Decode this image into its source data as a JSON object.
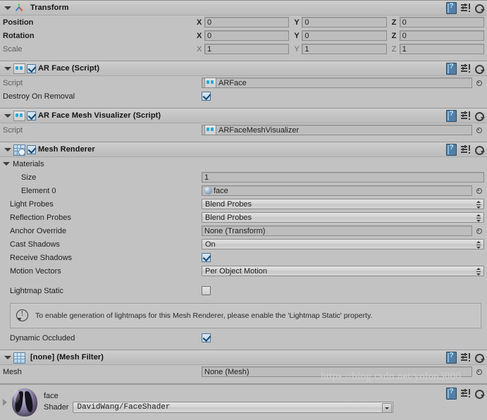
{
  "components": {
    "transform": {
      "title": "Transform",
      "rows": [
        {
          "label": "Position",
          "bold": true,
          "axes": [
            "X",
            "Y",
            "Z"
          ],
          "values": [
            "0",
            "0",
            "0"
          ]
        },
        {
          "label": "Rotation",
          "bold": true,
          "axes": [
            "X",
            "Y",
            "Z"
          ],
          "values": [
            "0",
            "0",
            "0"
          ]
        },
        {
          "label": "Scale",
          "bold": false,
          "axes": [
            "X",
            "Y",
            "Z"
          ],
          "values": [
            "1",
            "1",
            "1"
          ]
        }
      ]
    },
    "ar_face": {
      "title": "AR Face (Script)",
      "enabled": true,
      "script_label": "Script",
      "script_value": "ARFace",
      "destroy_label": "Destroy On Removal",
      "destroy_checked": true
    },
    "ar_face_mesh_visualizer": {
      "title": "AR Face Mesh Visualizer (Script)",
      "enabled": true,
      "script_label": "Script",
      "script_value": "ARFaceMeshVisualizer"
    },
    "mesh_renderer": {
      "title": "Mesh Renderer",
      "enabled": true,
      "materials_label": "Materials",
      "size_label": "Size",
      "size_value": "1",
      "element0_label": "Element 0",
      "element0_value": "face",
      "light_probes_label": "Light Probes",
      "light_probes_value": "Blend Probes",
      "reflection_probes_label": "Reflection Probes",
      "reflection_probes_value": "Blend Probes",
      "anchor_override_label": "Anchor Override",
      "anchor_override_value": "None (Transform)",
      "cast_shadows_label": "Cast Shadows",
      "cast_shadows_value": "On",
      "receive_shadows_label": "Receive Shadows",
      "receive_shadows_checked": true,
      "motion_vectors_label": "Motion Vectors",
      "motion_vectors_value": "Per Object Motion",
      "lightmap_static_label": "Lightmap Static",
      "lightmap_static_checked": false,
      "info_message": "To enable generation of lightmaps for this Mesh Renderer, please enable the 'Lightmap Static' property.",
      "dynamic_occluded_label": "Dynamic Occluded",
      "dynamic_occluded_checked": true
    },
    "mesh_filter": {
      "title": "[none] (Mesh Filter)",
      "mesh_label": "Mesh",
      "mesh_value": "None (Mesh)"
    },
    "material": {
      "name": "face",
      "shader_label": "Shader",
      "shader_value": "DavidWang/FaceShader"
    }
  },
  "watermark": "https://blog.csdn.net/yolon3000",
  "colors": {
    "background": "#c2c2c2",
    "field": "#bdbdbd",
    "accent_blue": "#29a8d8",
    "checkbox_check": "#17436e"
  }
}
